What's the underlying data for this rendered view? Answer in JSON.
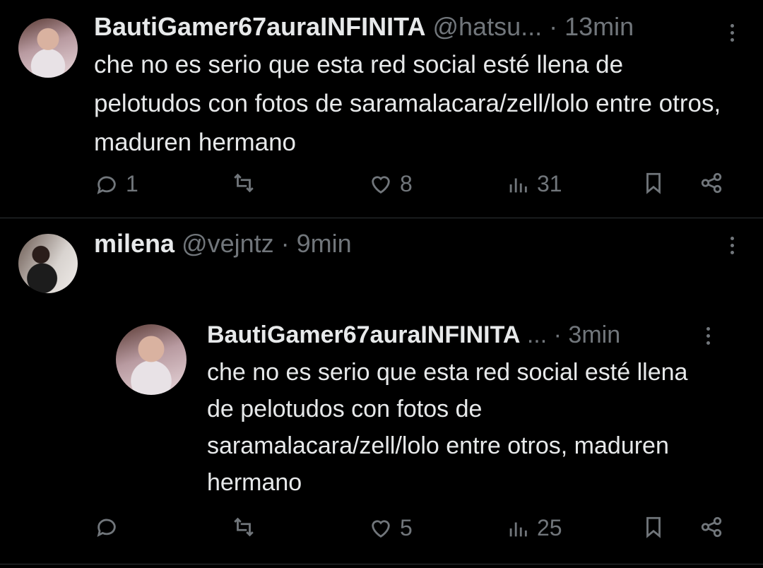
{
  "tweets": [
    {
      "display_name": "BautiGamer67auraINFINITA",
      "handle": "@hatsu...",
      "time": "· 13min",
      "text": "che no es serio que esta red social esté llena de pelotudos con fotos de saramalacara/zell/lolo entre otros, maduren hermano",
      "replies": "1",
      "retweets": "",
      "likes": "8",
      "views": "31"
    },
    {
      "display_name": "milena",
      "handle": "@vejntz",
      "time": "· 9min",
      "text": "",
      "quote": {
        "display_name": "BautiGamer67auraINFINITA",
        "ellipsis": "...",
        "time": "· 3min",
        "text": "che no es serio que esta red social esté llena de pelotudos con fotos de saramalacara/zell/lolo entre otros, maduren hermano"
      },
      "replies": "",
      "retweets": "",
      "likes": "5",
      "views": "25"
    }
  ],
  "colors": {
    "background": "#000000",
    "text": "#e7e9ea",
    "muted": "#71767b",
    "divider": "#2f3336"
  }
}
